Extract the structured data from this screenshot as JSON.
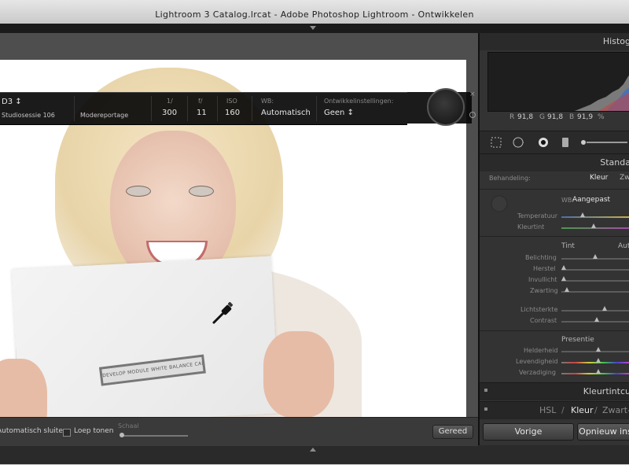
{
  "window": {
    "title": "Lightroom 3 Catalog.lrcat - Adobe Photoshop Lightroom - Ontwikkelen"
  },
  "photo": {
    "card_label": "DEVELOP MODULE WHITE BALANCE CARD"
  },
  "hud": {
    "camera": "D3 ↕",
    "session": "Studiosessie 106",
    "session2": "Modereportage",
    "shutter_label": "1/",
    "shutter_value": "300",
    "aperture_label": "f/",
    "aperture_value": "11",
    "iso_label": "ISO",
    "iso_value": "160",
    "wb_label": "WB:",
    "wb_value": "Automatisch",
    "develop_label": "Ontwikkelinstellingen:",
    "develop_value": "Geen ↕",
    "close_symbol": "×"
  },
  "toolbar": {
    "auto_close": "Automatisch sluiten",
    "loupe_tones": "Loep tonen",
    "scale_label": "Schaal",
    "done": "Gereed"
  },
  "right_panel": {
    "histogram_title": "Histog",
    "rgb": {
      "r_label": "R",
      "r": "91,8",
      "g_label": "G",
      "g": "91,8",
      "b_label": "B",
      "b": "91,9",
      "pct": "%"
    },
    "standard_title": "Standa",
    "treatment_label": "Behandeling:",
    "treatment_color": "Kleur",
    "treatment_bw": "Zw",
    "wb_label": "WB:",
    "wb_value": "Aangepast",
    "temperature": "Temperatuur",
    "tint_slider": "Kleurtint",
    "tone_title": "Tint",
    "tone_auto": "Auto",
    "exposure": "Belichting",
    "recovery": "Herstel",
    "fill_light": "Invullicht",
    "blacks": "Zwarting",
    "brightness": "Lichtsterkte",
    "contrast": "Contrast",
    "presence_title": "Presentie",
    "clarity": "Helderheid",
    "vibrance": "Levendigheid",
    "saturation": "Verzadiging",
    "tone_curve_title": "Kleurtintcu",
    "hsl": "HSL",
    "slash1": "/",
    "color": "Kleur",
    "slash2": "/",
    "bw": "Zwart-",
    "prev_button": "Vorige",
    "reset_button": "Opnieuw ins"
  },
  "colors": {
    "panel_bg": "#333333",
    "hud_bg": "#0a0a0a",
    "title_bar": "#d8d8d8"
  }
}
